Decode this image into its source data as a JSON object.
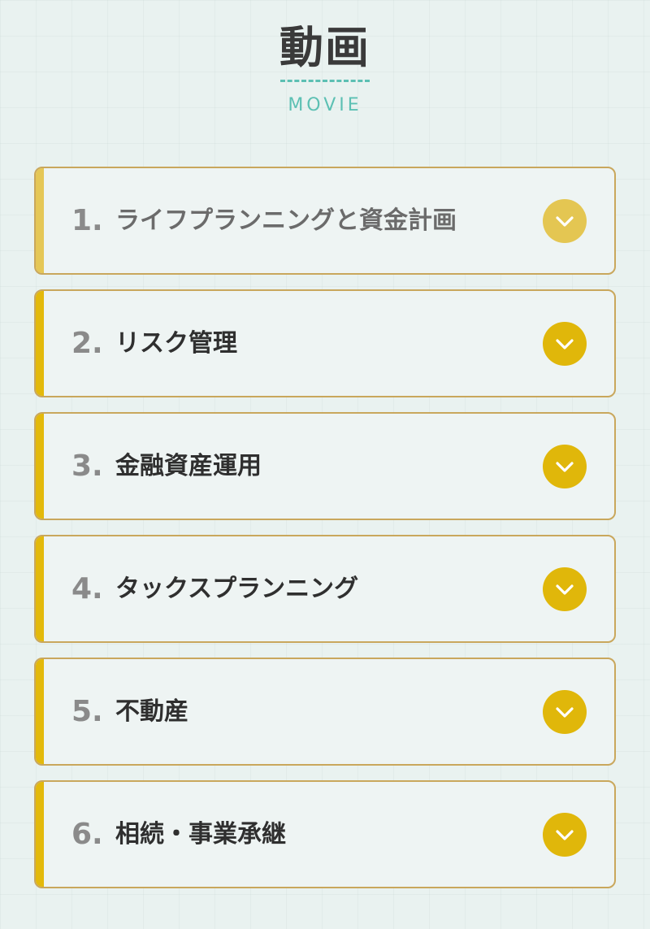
{
  "header": {
    "title_jp": "動画",
    "title_en": "MOVIE"
  },
  "colors": {
    "background": "#e9f2f0",
    "accent_teal": "#5cc0b3",
    "accent_gold": "#e0b70a",
    "border_gold": "#c9a75c",
    "text_dark": "#2f2f2f",
    "number_gray": "#8a8a8a"
  },
  "items": [
    {
      "number": "1.",
      "label": "ライフプランニングと資金計画",
      "icon": "chevron-down-icon"
    },
    {
      "number": "2.",
      "label": "リスク管理",
      "icon": "chevron-down-icon"
    },
    {
      "number": "3.",
      "label": "金融資産運用",
      "icon": "chevron-down-icon"
    },
    {
      "number": "4.",
      "label": "タックスプランニング",
      "icon": "chevron-down-icon"
    },
    {
      "number": "5.",
      "label": "不動産",
      "icon": "chevron-down-icon"
    },
    {
      "number": "6.",
      "label": "相続・事業承継",
      "icon": "chevron-down-icon"
    }
  ]
}
